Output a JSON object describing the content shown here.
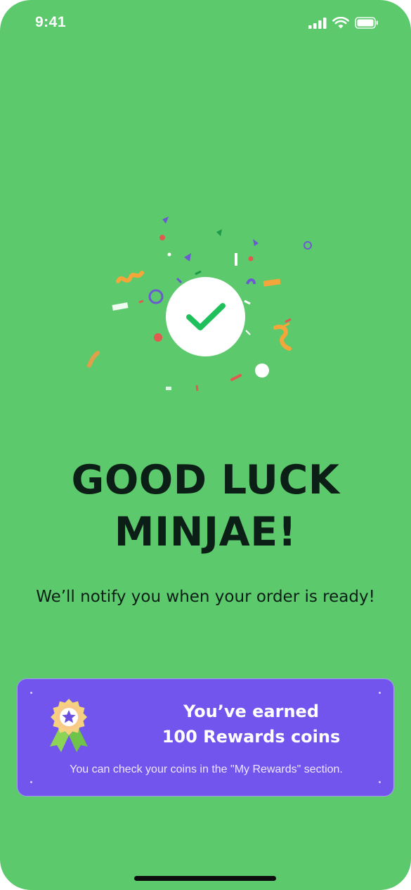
{
  "status_bar": {
    "time": "9:41",
    "icons": [
      "cellular-signal-icon",
      "wifi-icon",
      "battery-icon"
    ]
  },
  "success": {
    "icon": "checkmark-icon",
    "headline_line1": "GOOD LUCK",
    "headline_line2": "MINJAE!",
    "subtitle": "We’ll notify you when your order is ready!"
  },
  "reward": {
    "icon": "award-medal-icon",
    "title_line1": "You’ve earned",
    "title_line2": "100 Rewards coins",
    "note": "You can check your coins in the \"My Rewards\" section."
  },
  "colors": {
    "background": "#5dc96d",
    "card": "#7155ec",
    "check": "#1fbf5c",
    "text_dark": "#0c1f16"
  }
}
